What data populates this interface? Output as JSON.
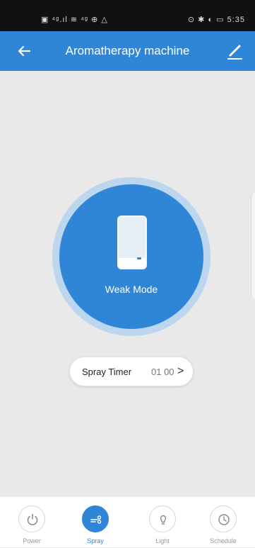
{
  "status_bar": {
    "left_icons": "▣ ⁴ᵍ.ıl ≋ ⁴ᵍ ⊕ △",
    "right_text": "⊙ ✱ ◐ ▭ 5:35"
  },
  "app_bar": {
    "title": "Aromatherapy machine",
    "back_icon": "arrow-left",
    "edit_icon": "pencil"
  },
  "device": {
    "mode": "Weak Mode",
    "accent_color": "#2f86d6"
  },
  "timer": {
    "label": "Spray Timer",
    "value": "01 00",
    "chevron": ">"
  },
  "nav": {
    "items": [
      {
        "label": "Power",
        "icon": "power-icon",
        "active": false
      },
      {
        "label": "Spray",
        "icon": "spray-icon",
        "active": true
      },
      {
        "label": "Light",
        "icon": "bulb-icon",
        "active": false
      },
      {
        "label": "Schedule",
        "icon": "clock-icon",
        "active": false
      }
    ]
  }
}
